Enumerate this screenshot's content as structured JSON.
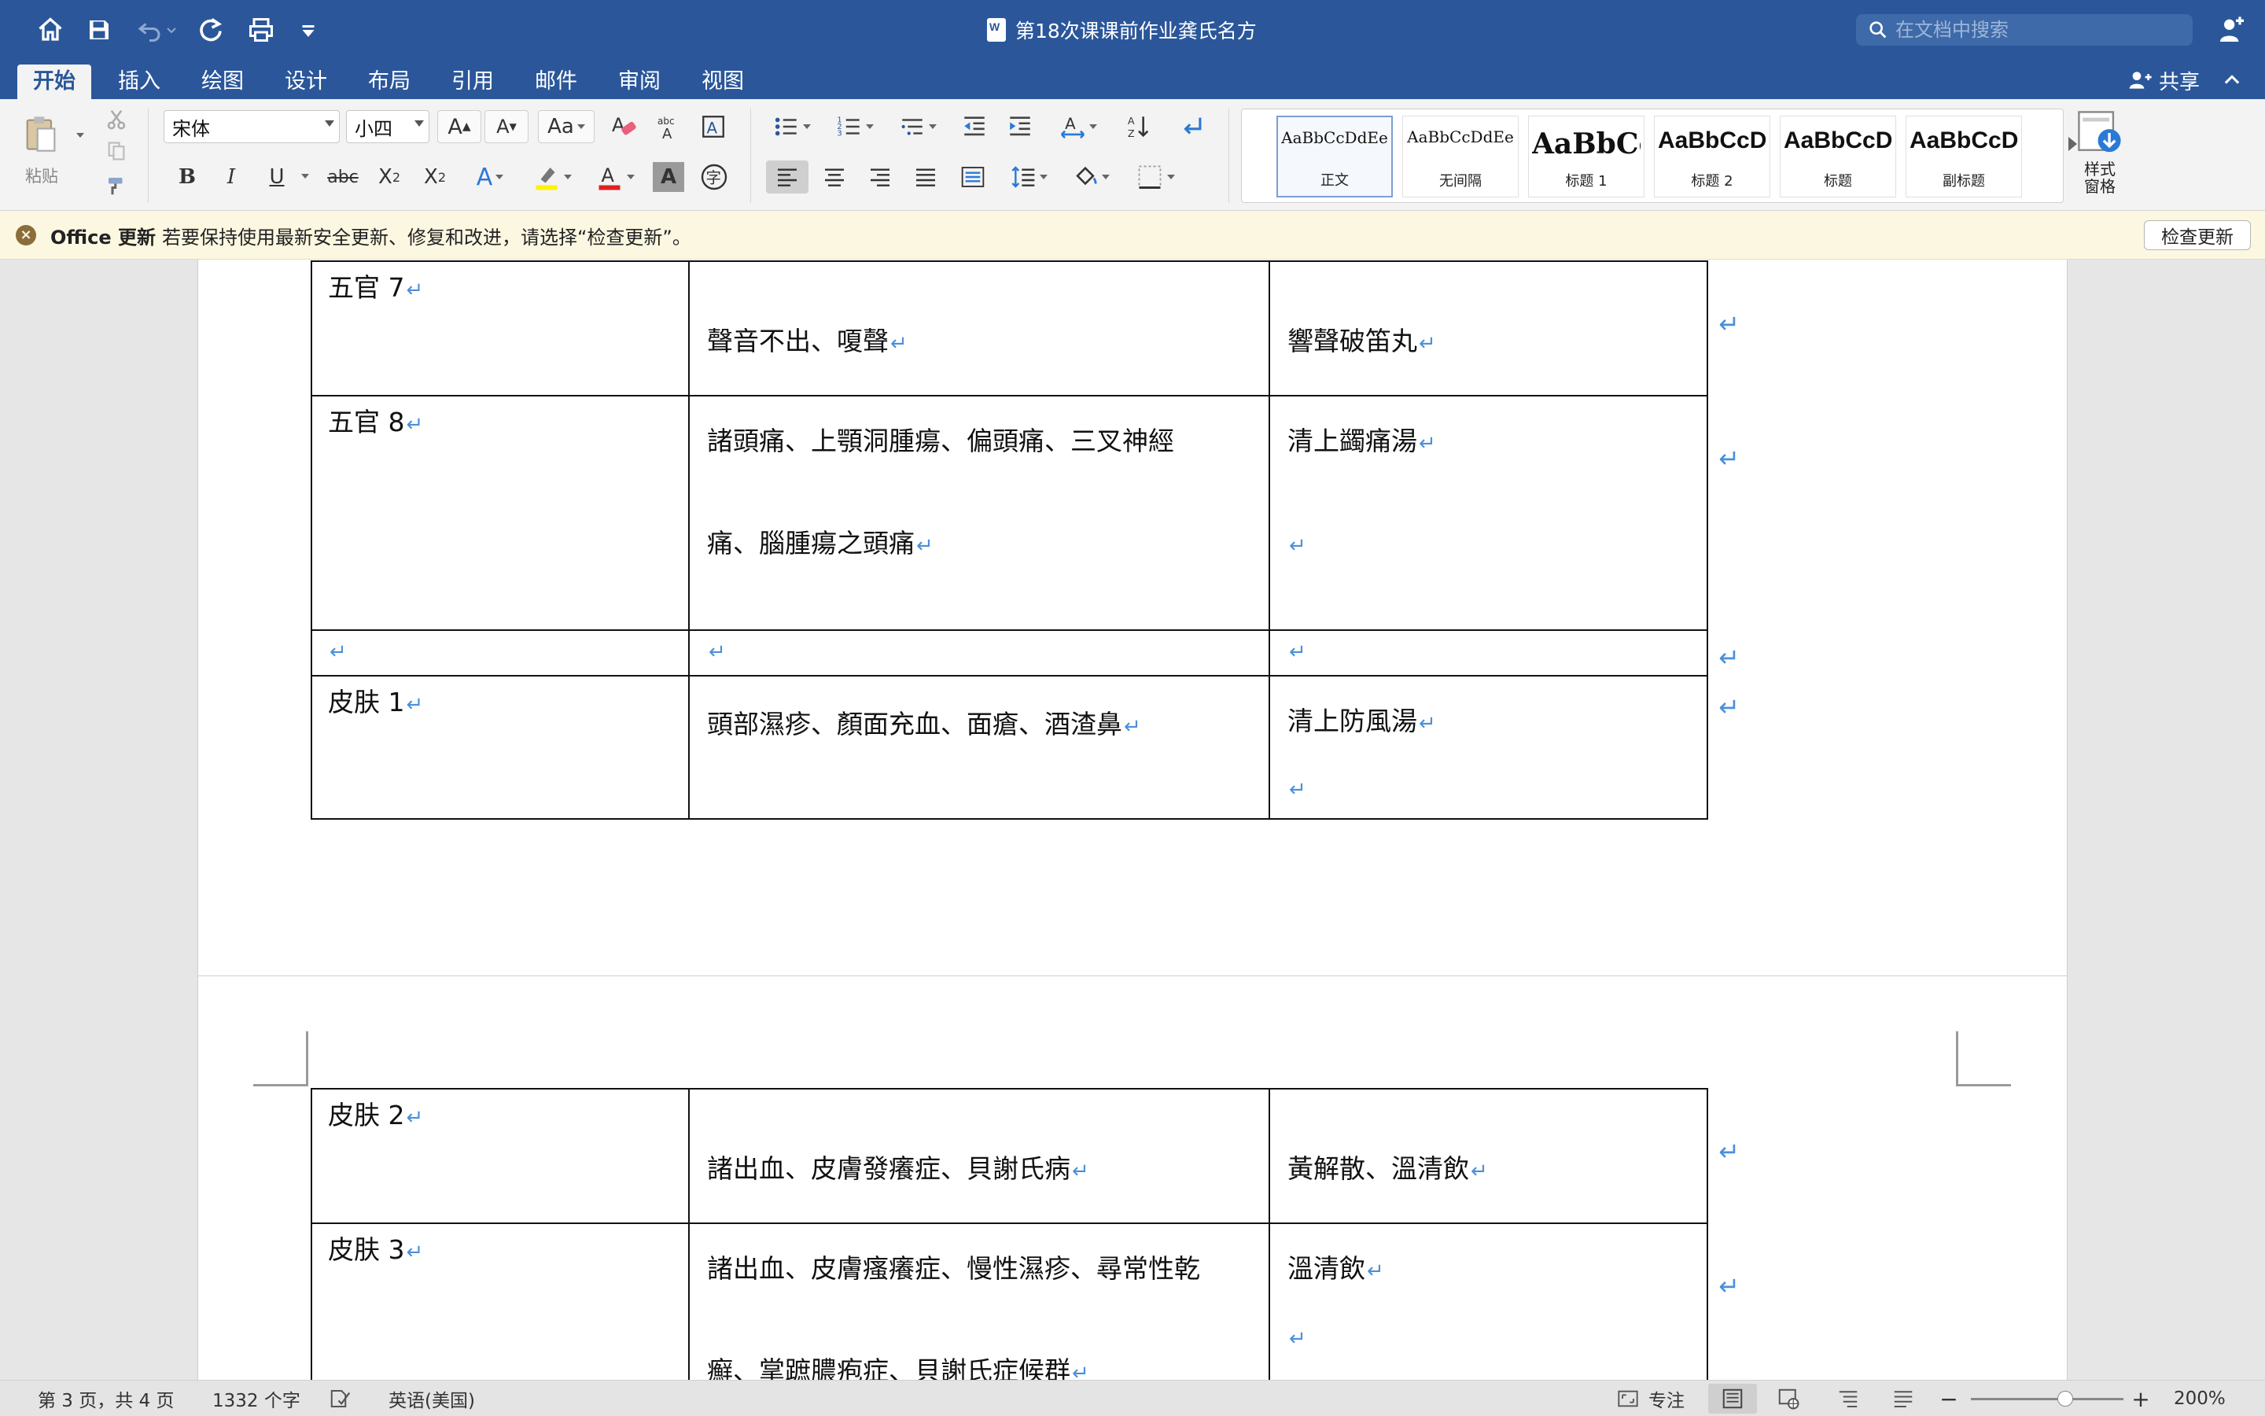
{
  "titlebar": {
    "doc_title": "第18次课课前作业龚氏名方",
    "search_placeholder": "在文档中搜索"
  },
  "ribbon_tabs": [
    "开始",
    "插入",
    "绘图",
    "设计",
    "布局",
    "引用",
    "邮件",
    "审阅",
    "视图"
  ],
  "active_tab": "开始",
  "share_label": "共享",
  "clipboard": {
    "paste_label": "粘贴"
  },
  "font": {
    "name": "宋体",
    "size": "小四"
  },
  "styles": [
    {
      "sample": "AaBbCcDdEe",
      "name": "正文"
    },
    {
      "sample": "AaBbCcDdEe",
      "name": "无间隔"
    },
    {
      "sample": "AaBbCc",
      "name": "标题 1"
    },
    {
      "sample": "AaBbCcD",
      "name": "标题 2"
    },
    {
      "sample": "AaBbCcD",
      "name": "标题"
    },
    {
      "sample": "AaBbCcD",
      "name": "副标题"
    }
  ],
  "styles_pane_label": "样式\n窗格",
  "infobar": {
    "title": "Office 更新",
    "message": "若要保持使用最新安全更新、修复和改进，请选择“检查更新”。",
    "button": "检查更新"
  },
  "page3_table": [
    {
      "c1": "五官 7",
      "c2": [
        "聲音不出、嗄聲"
      ],
      "c3": [
        "響聲破笛丸"
      ]
    },
    {
      "c1": "五官 8",
      "c2": [
        "諸頭痛、上顎洞腫瘍、偏頭痛、三叉神經",
        "痛、腦腫瘍之頭痛"
      ],
      "c3": [
        "清上蠲痛湯",
        ""
      ]
    },
    {
      "c1": "",
      "c2": [
        ""
      ],
      "c3": [
        ""
      ]
    },
    {
      "c1": "皮肤 1",
      "c2": [
        "頭部濕疹、顏面充血、面瘡、酒渣鼻"
      ],
      "c3": [
        "清上防風湯",
        ""
      ]
    }
  ],
  "page4_table": [
    {
      "c1": "皮肤 2",
      "c2": [
        "諸出血、皮膚發癢症、貝謝氏病"
      ],
      "c3": [
        "黃解散、溫清飲"
      ]
    },
    {
      "c1": "皮肤 3",
      "c2": [
        "諸出血、皮膚瘙癢症、慢性濕疹、尋常性乾",
        "癬、掌蹠膿疱症、貝謝氏症候群"
      ],
      "c3": [
        "溫清飲",
        ""
      ]
    }
  ],
  "statusbar": {
    "page_info": "第 3 页，共 4 页",
    "word_count": "1332 个字",
    "language": "英语(美国)",
    "focus": "专注",
    "zoom": "200%",
    "zoom_fraction": 0.62
  },
  "colors": {
    "title_bar": "#2b579a",
    "ribbon": "#f3f3f3",
    "infobar": "#fcf7e1",
    "paragraph_mark": "#4a90d9"
  }
}
